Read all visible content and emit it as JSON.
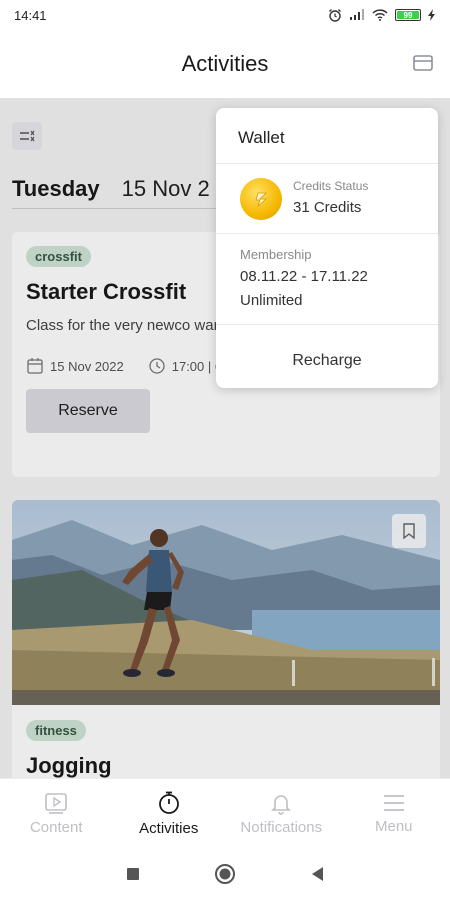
{
  "status_bar": {
    "time": "14:41",
    "battery": "99"
  },
  "header": {
    "title": "Activities",
    "wallet_icon": "card-icon"
  },
  "day": {
    "name": "Tuesday",
    "date": "15 Nov 2"
  },
  "card1": {
    "tag": "crossfit",
    "title": "Starter Crossfit",
    "description": "Class for the very newco want to workout at their",
    "date": "15 Nov 2022",
    "time": "17:00 | 60 min",
    "reserve_label": "Reserve"
  },
  "card2": {
    "tag": "fitness",
    "title": "Jogging"
  },
  "wallet": {
    "title": "Wallet",
    "credits_label": "Credits Status",
    "credits_value": "31 Credits",
    "membership_label": "Membership",
    "membership_dates": "08.11.22 - 17.11.22",
    "membership_type": "Unlimited",
    "recharge_label": "Recharge"
  },
  "nav": [
    {
      "label": "Content",
      "icon": "play-icon",
      "active": false
    },
    {
      "label": "Activities",
      "icon": "stopwatch-icon",
      "active": true
    },
    {
      "label": "Notifications",
      "icon": "bell-icon",
      "active": false
    },
    {
      "label": "Menu",
      "icon": "menu-icon",
      "active": false
    }
  ],
  "colors": {
    "accent_tag_bg": "#cfe5d6",
    "coin": "#f5b800",
    "nav_inactive": "#c0c0c4"
  }
}
